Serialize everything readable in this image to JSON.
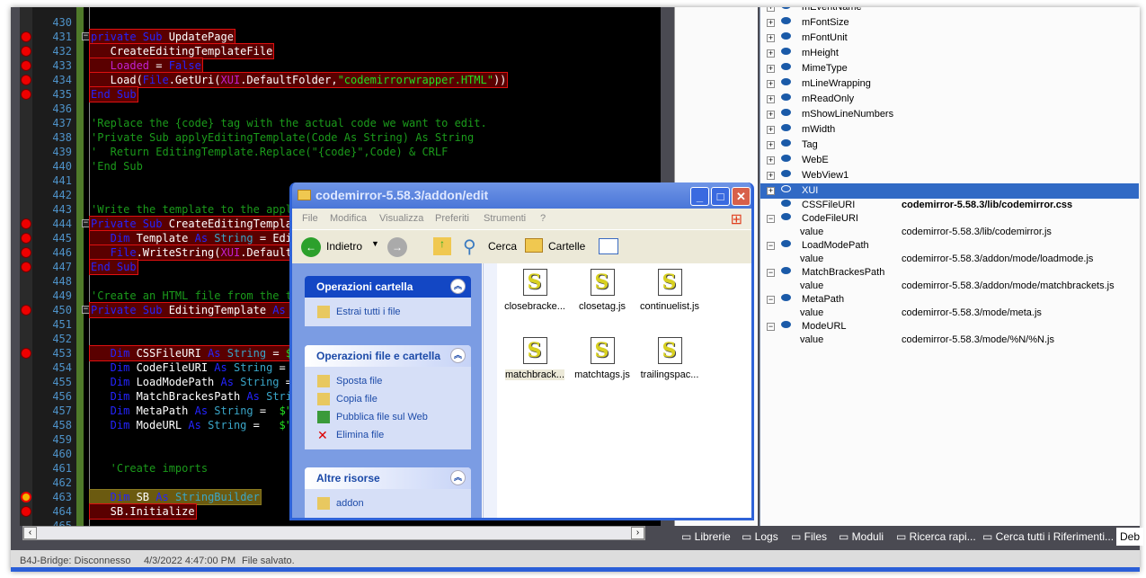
{
  "editor": {
    "lines": [
      {
        "n": "430",
        "bp": false,
        "hl": "",
        "tokens": []
      },
      {
        "n": "431",
        "bp": true,
        "hl": "hl",
        "fold": "−",
        "tokens": [
          [
            "kw",
            "private Sub "
          ],
          [
            "id",
            "UpdatePage"
          ]
        ]
      },
      {
        "n": "432",
        "bp": true,
        "hl": "hl",
        "tokens": [
          [
            "id",
            "   CreateEditingTemplateFile"
          ]
        ]
      },
      {
        "n": "433",
        "bp": true,
        "hl": "hl",
        "tokens": [
          [
            "mg",
            "   Loaded"
          ],
          [
            "id",
            " = "
          ],
          [
            "kw",
            "False"
          ]
        ]
      },
      {
        "n": "434",
        "bp": true,
        "hl": "hl",
        "tokens": [
          [
            "id",
            "   Load("
          ],
          [
            "kw",
            "File"
          ],
          [
            "id",
            ".GetUri("
          ],
          [
            "mg",
            "XUI"
          ],
          [
            "id",
            ".DefaultFolder,"
          ],
          [
            "str",
            "\"codemirrorwrapper.HTML\""
          ],
          [
            "id",
            "))"
          ]
        ]
      },
      {
        "n": "435",
        "bp": true,
        "hl": "hl",
        "tokens": [
          [
            "kw",
            "End Sub"
          ]
        ]
      },
      {
        "n": "436",
        "bp": false,
        "hl": "",
        "tokens": []
      },
      {
        "n": "437",
        "bp": false,
        "hl": "",
        "tokens": [
          [
            "cm",
            "'Replace the {code} tag with the actual code we want to edit."
          ]
        ]
      },
      {
        "n": "438",
        "bp": false,
        "hl": "",
        "tokens": [
          [
            "cm",
            "'Private Sub applyEditingTemplate(Code As String) As String"
          ]
        ]
      },
      {
        "n": "439",
        "bp": false,
        "hl": "",
        "tokens": [
          [
            "cm",
            "'  Return EditingTemplate.Replace(\"{code}\",Code) & CRLF"
          ]
        ]
      },
      {
        "n": "440",
        "bp": false,
        "hl": "",
        "tokens": [
          [
            "cm",
            "'End Sub"
          ]
        ]
      },
      {
        "n": "441",
        "bp": false,
        "hl": "",
        "tokens": []
      },
      {
        "n": "442",
        "bp": false,
        "hl": "",
        "tokens": []
      },
      {
        "n": "443",
        "bp": false,
        "hl": "",
        "tokens": [
          [
            "cm",
            "'Write the template to the appli"
          ]
        ]
      },
      {
        "n": "444",
        "bp": true,
        "hl": "hl",
        "fold": "−",
        "tokens": [
          [
            "kw",
            "Private Sub "
          ],
          [
            "id",
            "CreateEditingTemplat"
          ]
        ]
      },
      {
        "n": "445",
        "bp": true,
        "hl": "hl",
        "tokens": [
          [
            "kw",
            "   Dim "
          ],
          [
            "id",
            "Template "
          ],
          [
            "kw",
            "As "
          ],
          [
            "ty",
            "String"
          ],
          [
            "id",
            " = Edit"
          ]
        ]
      },
      {
        "n": "446",
        "bp": true,
        "hl": "hl",
        "tokens": [
          [
            "kw",
            "   File"
          ],
          [
            "id",
            ".WriteString("
          ],
          [
            "mg",
            "XUI"
          ],
          [
            "id",
            ".DefaultF"
          ]
        ]
      },
      {
        "n": "447",
        "bp": true,
        "hl": "hl",
        "tokens": [
          [
            "kw",
            "End Sub"
          ]
        ]
      },
      {
        "n": "448",
        "bp": false,
        "hl": "",
        "tokens": []
      },
      {
        "n": "449",
        "bp": false,
        "hl": "",
        "tokens": [
          [
            "cm",
            "'Create an HTML file from the te"
          ]
        ]
      },
      {
        "n": "450",
        "bp": true,
        "hl": "hl",
        "fold": "−",
        "tokens": [
          [
            "kw",
            "Private Sub "
          ],
          [
            "id",
            "EditingTemplate "
          ],
          [
            "kw",
            "As "
          ],
          [
            "ty",
            "S"
          ]
        ]
      },
      {
        "n": "451",
        "bp": false,
        "hl": "",
        "tokens": []
      },
      {
        "n": "452",
        "bp": false,
        "hl": "",
        "tokens": []
      },
      {
        "n": "453",
        "bp": true,
        "hl": "hl",
        "tokens": [
          [
            "kw",
            "   Dim "
          ],
          [
            "id",
            "CSSFileURI "
          ],
          [
            "kw",
            "As "
          ],
          [
            "ty",
            "String"
          ],
          [
            "id",
            " = "
          ],
          [
            "str",
            "$\""
          ]
        ]
      },
      {
        "n": "454",
        "bp": false,
        "hl": "",
        "tokens": [
          [
            "kw",
            "   Dim "
          ],
          [
            "id",
            "CodeFileURI "
          ],
          [
            "kw",
            "As "
          ],
          [
            "ty",
            "String"
          ],
          [
            "id",
            " = "
          ],
          [
            "str",
            "$"
          ]
        ]
      },
      {
        "n": "455",
        "bp": false,
        "hl": "",
        "tokens": [
          [
            "kw",
            "   Dim "
          ],
          [
            "id",
            "LoadModePath "
          ],
          [
            "kw",
            "As "
          ],
          [
            "ty",
            "String"
          ],
          [
            "id",
            " ="
          ]
        ]
      },
      {
        "n": "456",
        "bp": false,
        "hl": "",
        "tokens": [
          [
            "kw",
            "   Dim "
          ],
          [
            "id",
            "MatchBrackesPath "
          ],
          [
            "kw",
            "As "
          ],
          [
            "ty",
            "Strin"
          ]
        ]
      },
      {
        "n": "457",
        "bp": false,
        "hl": "",
        "tokens": [
          [
            "kw",
            "   Dim "
          ],
          [
            "id",
            "MetaPath "
          ],
          [
            "kw",
            "As "
          ],
          [
            "ty",
            "String"
          ],
          [
            "id",
            " =  "
          ],
          [
            "str",
            "$\"$"
          ]
        ]
      },
      {
        "n": "458",
        "bp": false,
        "hl": "",
        "tokens": [
          [
            "kw",
            "   Dim "
          ],
          [
            "id",
            "ModeURL "
          ],
          [
            "kw",
            "As "
          ],
          [
            "ty",
            "String"
          ],
          [
            "id",
            " =   "
          ],
          [
            "str",
            "$\"$"
          ]
        ]
      },
      {
        "n": "459",
        "bp": false,
        "hl": "",
        "tokens": []
      },
      {
        "n": "460",
        "bp": false,
        "hl": "",
        "tokens": []
      },
      {
        "n": "461",
        "bp": false,
        "hl": "",
        "tokens": [
          [
            "cm",
            "   'Create imports"
          ]
        ]
      },
      {
        "n": "462",
        "bp": false,
        "hl": "",
        "tokens": []
      },
      {
        "n": "463",
        "bp": "cur",
        "hl": "cl",
        "tokens": [
          [
            "kw",
            "   Dim "
          ],
          [
            "id",
            "SB "
          ],
          [
            "kw",
            "As "
          ],
          [
            "ty",
            "StringBuilder"
          ]
        ]
      },
      {
        "n": "464",
        "bp": true,
        "hl": "hl",
        "tokens": [
          [
            "id",
            "   SB.Initialize"
          ]
        ]
      },
      {
        "n": "465",
        "bp": false,
        "hl": "",
        "tokens": []
      }
    ]
  },
  "tree": {
    "items": [
      {
        "name": "mEventName",
        "sel": false
      },
      {
        "name": "mFontSize",
        "sel": false
      },
      {
        "name": "mFontUnit",
        "sel": false
      },
      {
        "name": "mHeight",
        "sel": false
      },
      {
        "name": "MimeType",
        "sel": false
      },
      {
        "name": "mLineWrapping",
        "sel": false
      },
      {
        "name": "mReadOnly",
        "sel": false
      },
      {
        "name": "mShowLineNumbers",
        "sel": false
      },
      {
        "name": "mWidth",
        "sel": false
      },
      {
        "name": "Tag",
        "sel": false
      },
      {
        "name": "WebE",
        "sel": false
      },
      {
        "name": "WebView1",
        "sel": false
      },
      {
        "name": "XUI",
        "sel": true
      }
    ],
    "locals": [
      {
        "name": "CSSFileURI",
        "value": "codemirror-5.58.3/lib/codemirror.css",
        "bold": true
      },
      {
        "name": "CodeFileURI",
        "child": "value",
        "value": "codemirror-5.58.3/lib/codemirror.js"
      },
      {
        "name": "LoadModePath",
        "child": "value",
        "value": "codemirror-5.58.3/addon/mode/loadmode.js"
      },
      {
        "name": "MatchBrackesPath",
        "child": "value",
        "value": "codemirror-5.58.3/addon/mode/matchbrackets.js"
      },
      {
        "name": "MetaPath",
        "child": "value",
        "value": "codemirror-5.58.3/mode/meta.js"
      },
      {
        "name": "ModeURL",
        "child": "value",
        "value": "codemirror-5.58.3/mode/%N/%N.js"
      }
    ]
  },
  "tabs": [
    {
      "label": "Librerie",
      "icon": "book-icon"
    },
    {
      "label": "Logs",
      "icon": "list-icon"
    },
    {
      "label": "Files",
      "icon": "folder-icon"
    },
    {
      "label": "Moduli",
      "icon": "grid-icon"
    },
    {
      "label": "Ricerca rapi...",
      "icon": "search-icon"
    },
    {
      "label": "Cerca tutti i Riferimenti...",
      "icon": "find-references-icon"
    },
    {
      "label": "Deb",
      "active": true
    }
  ],
  "status": {
    "bridge": "B4J-Bridge: Disconnesso",
    "time": "4/3/2022 4:47:00 PM",
    "message": "File salvato."
  },
  "explorer": {
    "title": "codemirror-5.58.3/addon/edit",
    "menu": [
      "File",
      "Modifica",
      "Visualizza",
      "Preferiti",
      "Strumenti",
      "?"
    ],
    "toolbar": {
      "back": "Indietro",
      "search": "Cerca",
      "folders": "Cartelle"
    },
    "panels": [
      {
        "title": "Operazioni cartella",
        "dark": true,
        "items": [
          {
            "label": "Estrai tutti i file",
            "icon": "zip-folder-icon"
          }
        ]
      },
      {
        "title": "Operazioni file e cartella",
        "items": [
          {
            "label": "Sposta file",
            "icon": "move-icon"
          },
          {
            "label": "Copia file",
            "icon": "copy-icon"
          },
          {
            "label": "Pubblica file sul Web",
            "icon": "globe-icon"
          },
          {
            "label": "Elimina file",
            "icon": "delete-icon"
          }
        ]
      },
      {
        "title": "Altre risorse",
        "items": [
          {
            "label": "addon",
            "icon": "folder-icon"
          }
        ]
      }
    ],
    "files": [
      "closebracke...",
      "closetag.js",
      "continuelist.js",
      "matchbrack...",
      "matchtags.js",
      "trailingspac..."
    ]
  },
  "colors": {
    "keyword": "#2424ff",
    "comment": "#1b9a1b",
    "string": "#22e022",
    "breakpoint": "#e00000",
    "selection": "#316ac5"
  }
}
